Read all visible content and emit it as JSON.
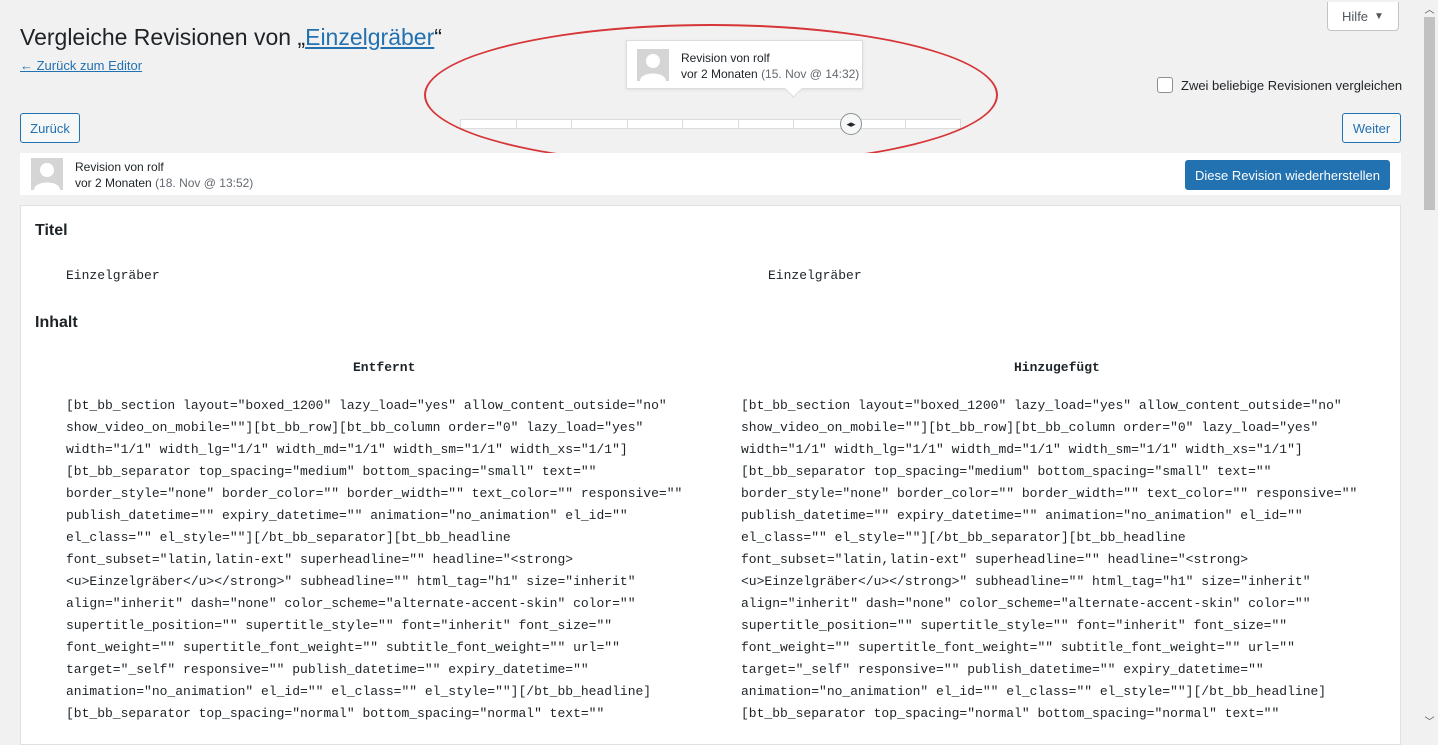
{
  "header": {
    "title_prefix": "Vergleiche Revisionen von „",
    "title_link": "Einzelgräber",
    "title_suffix": "“",
    "back_link": "← Zurück zum Editor"
  },
  "help": {
    "label": "Hilfe",
    "caret": "▼"
  },
  "compare_two": {
    "label": "Zwei beliebige Revisionen vergleichen",
    "checked": false
  },
  "nav": {
    "prev_label": "Zurück",
    "next_label": "Weiter"
  },
  "tooltip": {
    "prefix": "Revision von ",
    "author": "rolf",
    "time": "vor 2 Monaten",
    "date": "(15. Nov @ 14:32)"
  },
  "slider": {
    "ticks": 9,
    "handle_glyph": "◂▸"
  },
  "selected_revision": {
    "prefix": "Revision von ",
    "author": "rolf",
    "time": "vor 2 Monaten",
    "date": "(18. Nov @ 13:52)",
    "restore_label": "Diese Revision wiederherstellen"
  },
  "diff": {
    "title_heading": "Titel",
    "title_left": "Einzelgräber",
    "title_right": "Einzelgräber",
    "content_heading": "Inhalt",
    "removed_heading": "Entfernt",
    "added_heading": "Hinzugefügt",
    "left_text": "[bt_bb_section layout=\"boxed_1200\" lazy_load=\"yes\" allow_content_outside=\"no\"\nshow_video_on_mobile=\"\"][bt_bb_row][bt_bb_column order=\"0\" lazy_load=\"yes\"\nwidth=\"1/1\" width_lg=\"1/1\" width_md=\"1/1\" width_sm=\"1/1\" width_xs=\"1/1\"]\n[bt_bb_separator top_spacing=\"medium\" bottom_spacing=\"small\" text=\"\"\nborder_style=\"none\" border_color=\"\" border_width=\"\" text_color=\"\" responsive=\"\"\npublish_datetime=\"\" expiry_datetime=\"\" animation=\"no_animation\" el_id=\"\"\nel_class=\"\" el_style=\"\"][/bt_bb_separator][bt_bb_headline\nfont_subset=\"latin,latin-ext\" superheadline=\"\" headline=\"<strong>\n<u>Einzelgräber</u></strong>\" subheadline=\"\" html_tag=\"h1\" size=\"inherit\"\nalign=\"inherit\" dash=\"none\" color_scheme=\"alternate-accent-skin\" color=\"\"\nsupertitle_position=\"\" supertitle_style=\"\" font=\"inherit\" font_size=\"\"\nfont_weight=\"\" supertitle_font_weight=\"\" subtitle_font_weight=\"\" url=\"\"\ntarget=\"_self\" responsive=\"\" publish_datetime=\"\" expiry_datetime=\"\"\nanimation=\"no_animation\" el_id=\"\" el_class=\"\" el_style=\"\"][/bt_bb_headline]\n[bt_bb_separator top_spacing=\"normal\" bottom_spacing=\"normal\" text=\"\"",
    "right_text": "[bt_bb_section layout=\"boxed_1200\" lazy_load=\"yes\" allow_content_outside=\"no\"\nshow_video_on_mobile=\"\"][bt_bb_row][bt_bb_column order=\"0\" lazy_load=\"yes\"\nwidth=\"1/1\" width_lg=\"1/1\" width_md=\"1/1\" width_sm=\"1/1\" width_xs=\"1/1\"]\n[bt_bb_separator top_spacing=\"medium\" bottom_spacing=\"small\" text=\"\"\nborder_style=\"none\" border_color=\"\" border_width=\"\" text_color=\"\" responsive=\"\"\npublish_datetime=\"\" expiry_datetime=\"\" animation=\"no_animation\" el_id=\"\"\nel_class=\"\" el_style=\"\"][/bt_bb_separator][bt_bb_headline\nfont_subset=\"latin,latin-ext\" superheadline=\"\" headline=\"<strong>\n<u>Einzelgräber</u></strong>\" subheadline=\"\" html_tag=\"h1\" size=\"inherit\"\nalign=\"inherit\" dash=\"none\" color_scheme=\"alternate-accent-skin\" color=\"\"\nsupertitle_position=\"\" supertitle_style=\"\" font=\"inherit\" font_size=\"\"\nfont_weight=\"\" supertitle_font_weight=\"\" subtitle_font_weight=\"\" url=\"\"\ntarget=\"_self\" responsive=\"\" publish_datetime=\"\" expiry_datetime=\"\"\nanimation=\"no_animation\" el_id=\"\" el_class=\"\" el_style=\"\"][/bt_bb_headline]\n[bt_bb_separator top_spacing=\"normal\" bottom_spacing=\"normal\" text=\"\""
  },
  "colors": {
    "accent": "#2271b1",
    "highlight_oval": "#d63638",
    "background": "#f1f1f1"
  }
}
